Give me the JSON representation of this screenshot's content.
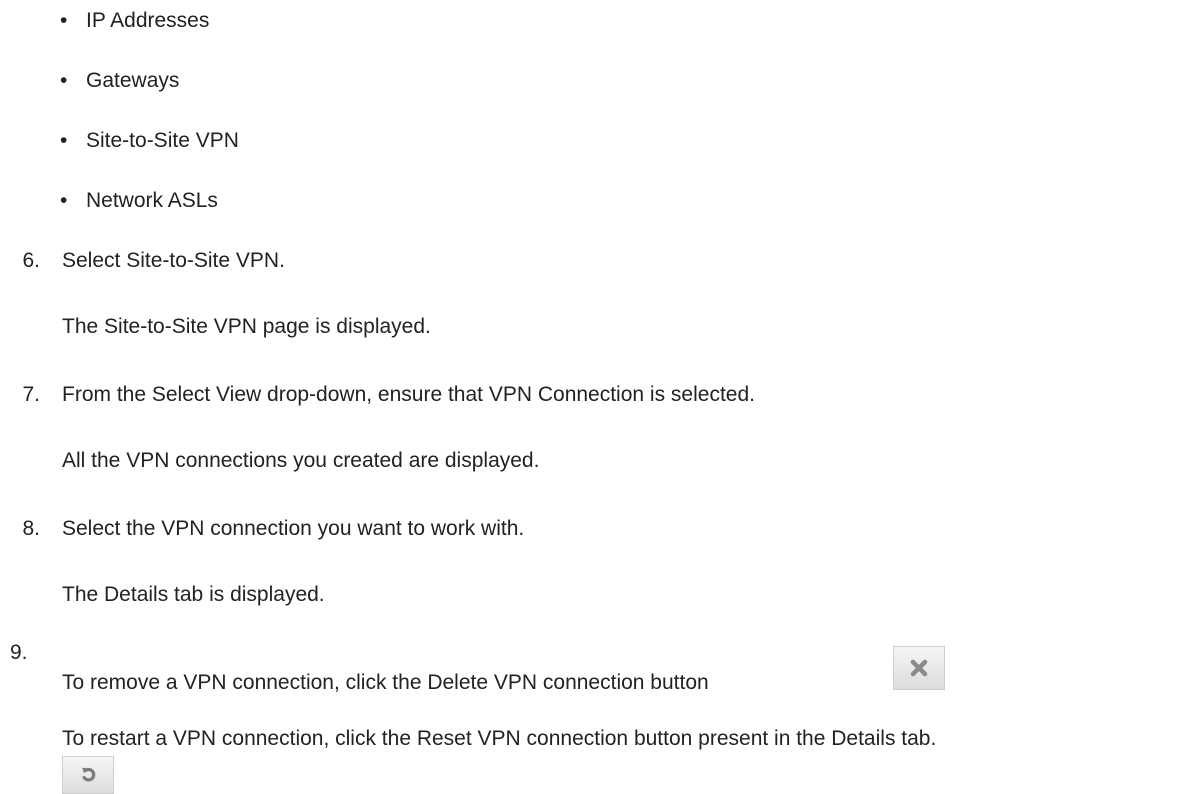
{
  "bullets": [
    "IP Addresses",
    "Gateways",
    "Site-to-Site VPN",
    "Network ASLs"
  ],
  "steps": [
    {
      "number": "6.",
      "text": "Select Site-to-Site VPN.",
      "result": "The Site-to-Site VPN page is displayed."
    },
    {
      "number": "7.",
      "text": "From the Select View drop-down, ensure that VPN Connection is selected.",
      "result": "All the VPN connections you created are displayed."
    },
    {
      "number": "8.",
      "text": "Select the VPN connection you want to work with.",
      "result": "The Details tab is displayed."
    },
    {
      "number": "9.",
      "text": "To remove a VPN connection, click the Delete VPN connection button",
      "result": "To restart a VPN connection, click the Reset VPN connection button present in the Details tab."
    }
  ],
  "icons": {
    "delete": "close-x-icon",
    "reset": "refresh-icon",
    "delete_color": "#8a8a8a",
    "reset_color": "#7a7a7a"
  }
}
